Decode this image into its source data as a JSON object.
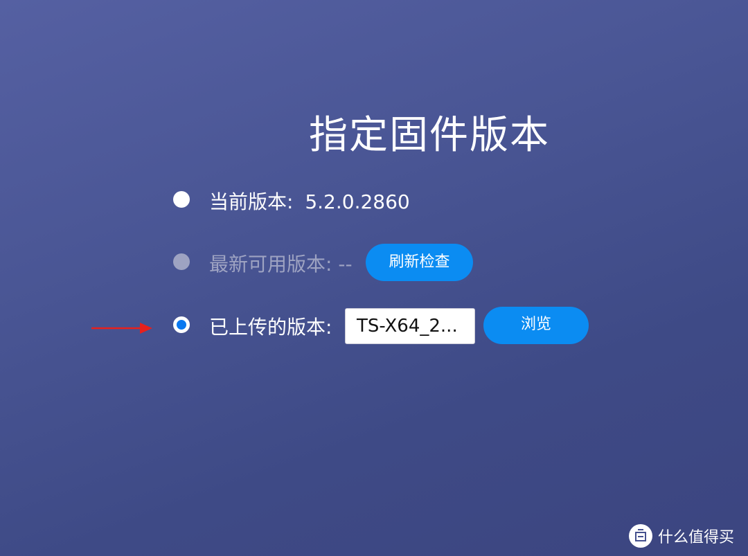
{
  "page": {
    "title": "指定固件版本"
  },
  "options": {
    "current": {
      "label": "当前版本:",
      "value": "5.2.0.2860"
    },
    "latest": {
      "label": "最新可用版本: --",
      "button_label": "刷新检查"
    },
    "uploaded": {
      "label": "已上传的版本:",
      "file_value": "TS-X64_2...",
      "button_label": "浏览"
    }
  },
  "watermark": {
    "text": "什么值得买",
    "logo_icon": "zhidemai-logo-icon"
  },
  "colors": {
    "accent": "#0b8cf2",
    "selected_radio": "#0a78f0",
    "arrow": "#e8201c",
    "background_top": "#5560a2",
    "background_bottom": "#3c4580"
  },
  "icons": {
    "arrow": "red-arrow-icon"
  }
}
